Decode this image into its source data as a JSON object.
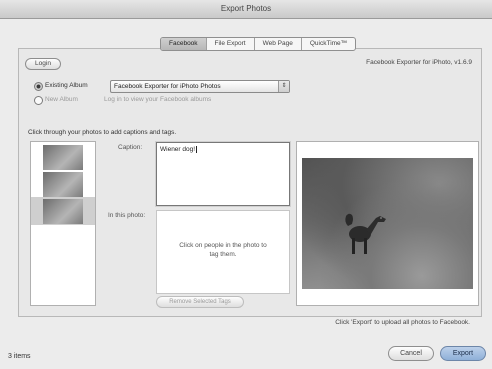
{
  "window": {
    "title": "Export Photos"
  },
  "tabs": [
    {
      "label": "Facebook",
      "active": true
    },
    {
      "label": "File Export",
      "active": false
    },
    {
      "label": "Web Page",
      "active": false
    },
    {
      "label": "QuickTime™",
      "active": false
    }
  ],
  "account": {
    "login_label": "Login",
    "version": "Facebook Exporter for iPhoto, v1.6.9"
  },
  "destination": {
    "existing_album_label": "Existing Album",
    "existing_album_selected": true,
    "album_value": "Facebook Exporter for iPhoto Photos",
    "new_album_label": "New Album",
    "login_hint": "Log in to view your Facebook albums"
  },
  "instructions": "Click through your photos to add captions and tags.",
  "editor": {
    "caption_label": "Caption:",
    "caption_value": "Wiener dog!",
    "in_this_photo_label": "In this photo:",
    "tag_hint": "Click on people in the photo to tag them.",
    "remove_tags_label": "Remove Selected Tags"
  },
  "footer": {
    "note": "Click 'Export' to upload all photos to Facebook.",
    "item_count": "3 items",
    "cancel_label": "Cancel",
    "export_label": "Export"
  },
  "colors": {
    "accent": "#8fb0d8",
    "panel": "#e8e8e8"
  }
}
